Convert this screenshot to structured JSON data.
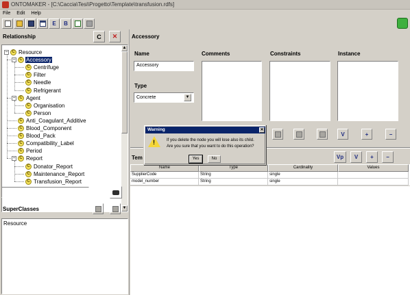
{
  "window": {
    "title": "ONTOMAKER - [C:\\Caccia\\Tesi\\Progetto\\Template\\transfusion.rdfs]"
  },
  "menu": [
    "File",
    "Edit",
    "Help"
  ],
  "toolbar": {
    "buttons": [
      "new-file",
      "open-folder",
      "save",
      "table",
      "E",
      "B",
      "check",
      "grid"
    ]
  },
  "relationship": {
    "header": "Relationship",
    "c_button": "C",
    "delete_button": "✕",
    "tree": [
      {
        "label": "Resource",
        "level": 0,
        "expander": "−"
      },
      {
        "label": "Accessory",
        "level": 1,
        "expander": "−",
        "selected": true
      },
      {
        "label": "Centrifuge",
        "level": 2
      },
      {
        "label": "Filter",
        "level": 2
      },
      {
        "label": "Needle",
        "level": 2
      },
      {
        "label": "Refrigerant",
        "level": 2
      },
      {
        "label": "Agent",
        "level": 1,
        "expander": "−"
      },
      {
        "label": "Organisation",
        "level": 2
      },
      {
        "label": "Person",
        "level": 2
      },
      {
        "label": "Anti_Coagulant_Additive",
        "level": 1
      },
      {
        "label": "Blood_Component",
        "level": 1
      },
      {
        "label": "Blood_Pack",
        "level": 1
      },
      {
        "label": "Compatibility_Label",
        "level": 1
      },
      {
        "label": "Period",
        "level": 1
      },
      {
        "label": "Report",
        "level": 1,
        "expander": "−"
      },
      {
        "label": "Donator_Report",
        "level": 2
      },
      {
        "label": "Maintenance_Report",
        "level": 2
      },
      {
        "label": "Transfusion_Report",
        "level": 2
      }
    ],
    "search_value": ""
  },
  "superclasses": {
    "header": "SuperClasses",
    "items": [
      "Resource"
    ]
  },
  "detail": {
    "header": "Accessory",
    "name_label": "Name",
    "name_value": "Accessory",
    "comments_label": "Comments",
    "constraints_label": "Constraints",
    "instance_label": "Instance",
    "type_label": "Type",
    "type_value": "Concrete",
    "constraint_btn_v": "V",
    "constraint_btn_plus": "+",
    "constraint_btn_minus": "−",
    "template_label": "Tem",
    "template_btn_vp": "Vp",
    "template_btn_v": "V",
    "template_btn_plus": "+",
    "template_btn_minus": "−",
    "table": {
      "columns": [
        "Name",
        "Type",
        "Cardinality",
        "Values"
      ],
      "rows": [
        [
          "SupplierCode",
          "String",
          "single",
          ""
        ],
        [
          "model_number",
          "String",
          "single",
          ""
        ]
      ]
    }
  },
  "dialog": {
    "title": "Warning",
    "line1": "If you delete the node you will lose also its child.",
    "line2": "Are you sure that you want to do this operation?",
    "yes": "Yes",
    "no": "No",
    "close": "✕",
    "icon_mark": "!"
  }
}
